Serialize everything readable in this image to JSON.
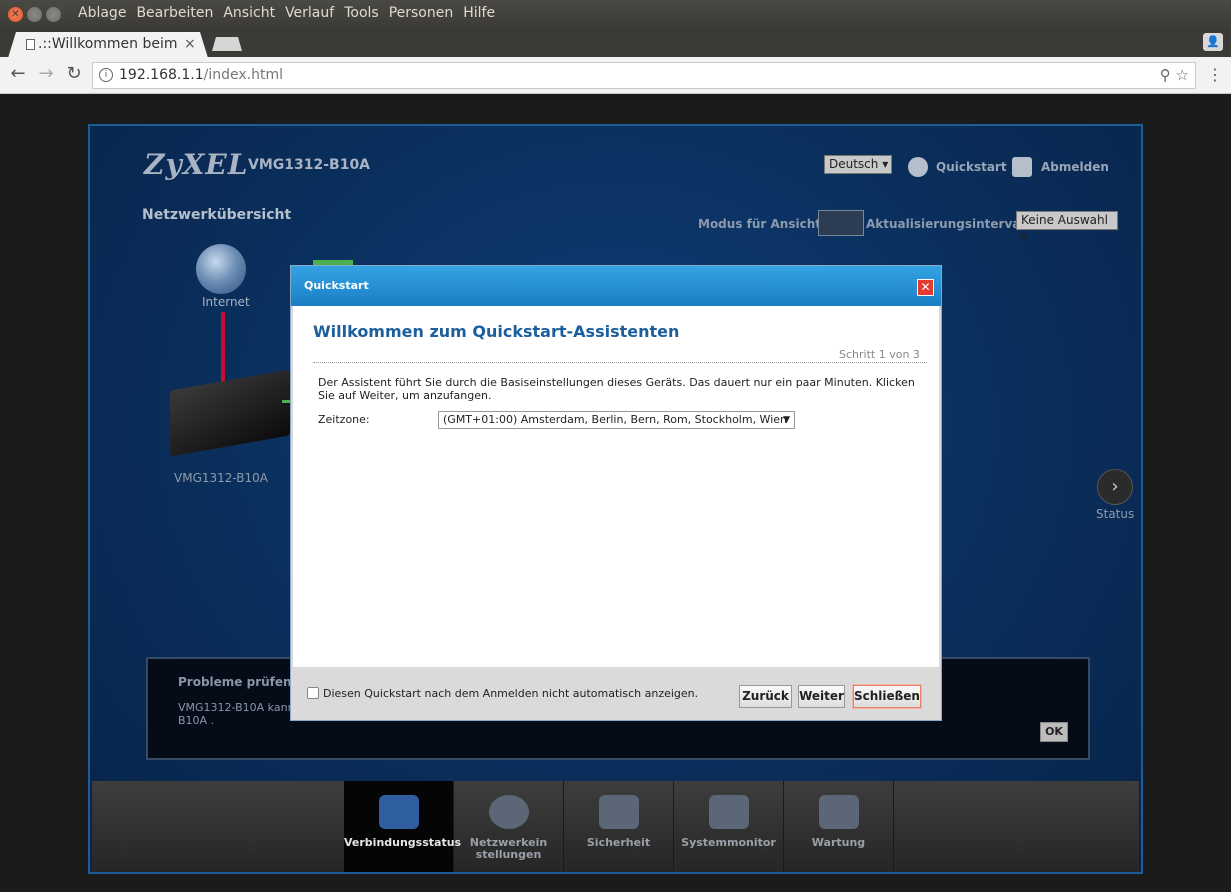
{
  "menubar": {
    "items": [
      "Ablage",
      "Bearbeiten",
      "Ansicht",
      "Verlauf",
      "Tools",
      "Personen",
      "Hilfe"
    ]
  },
  "browser": {
    "tab_title": ".::Willkommen beim",
    "url_host": "192.168.1.1",
    "url_path": "/index.html"
  },
  "router": {
    "logo": "ZyXEL",
    "model": "VMG1312-B10A",
    "language": "Deutsch",
    "quickstart": "Quickstart",
    "logout": "Abmelden",
    "section_title": "Netzwerkübersicht",
    "view_mode_label": "Modus für Ansicht:",
    "interval_label": "Aktualisierungsintervall:",
    "interval_value": "Keine Auswahl",
    "internet_label": "Internet",
    "device_label": "VMG1312-B10A",
    "status_label": "Status",
    "problems_title": "Probleme prüfen",
    "problems_text": "VMG1312-B10A kann B10A .",
    "ok": "OK",
    "nav": [
      {
        "label": "Verbindungsstatus",
        "active": true
      },
      {
        "label": "Netzwerkein stellungen",
        "active": false
      },
      {
        "label": "Sicherheit",
        "active": false
      },
      {
        "label": "Systemmonitor",
        "active": false
      },
      {
        "label": "Wartung",
        "active": false
      }
    ]
  },
  "dialog": {
    "title": "Quickstart",
    "heading": "Willkommen zum Quickstart-Assistenten",
    "step": "Schritt 1 von 3",
    "intro": "Der Assistent führt Sie durch die Basiseinstellungen dieses Geräts. Das dauert nur ein paar Minuten. Klicken Sie auf Weiter, um anzufangen.",
    "timezone_label": "Zeitzone:",
    "timezone_value": "(GMT+01:00) Amsterdam, Berlin, Bern, Rom, Stockholm, Wien",
    "checkbox_label": "Diesen Quickstart nach dem Anmelden nicht automatisch anzeigen.",
    "back": "Zurück",
    "next": "Weiter",
    "close": "Schließen"
  }
}
